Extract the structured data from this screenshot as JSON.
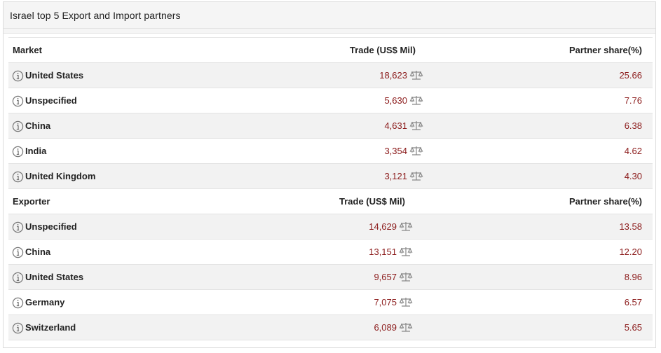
{
  "panel": {
    "title": "Israel top 5 Export and Import partners"
  },
  "sections": [
    {
      "headers": {
        "name": "Market",
        "trade": "Trade (US$ Mil)",
        "share": "Partner share(%)"
      },
      "rows": [
        {
          "name": "United States",
          "trade": "18,623",
          "share": "25.66"
        },
        {
          "name": "Unspecified",
          "trade": "5,630",
          "share": "7.76"
        },
        {
          "name": "China",
          "trade": "4,631",
          "share": "6.38"
        },
        {
          "name": "India",
          "trade": "3,354",
          "share": "4.62"
        },
        {
          "name": "United Kingdom",
          "trade": "3,121",
          "share": "4.30"
        }
      ]
    },
    {
      "headers": {
        "name": "Exporter",
        "trade": "Trade (US$ Mil)",
        "share": "Partner share(%)"
      },
      "rows": [
        {
          "name": "Unspecified",
          "trade": "14,629",
          "share": "13.58"
        },
        {
          "name": "China",
          "trade": "13,151",
          "share": "12.20"
        },
        {
          "name": "United States",
          "trade": "9,657",
          "share": "8.96"
        },
        {
          "name": "Germany",
          "trade": "7,075",
          "share": "6.57"
        },
        {
          "name": "Switzerland",
          "trade": "6,089",
          "share": "5.65"
        }
      ]
    }
  ],
  "icons": {
    "info": "info-circle-icon",
    "compare": "balance-scale-icon"
  },
  "colors": {
    "value": "#8b1a1a",
    "alt_row": "#f2f2f2",
    "header_bg": "#f5f5f5"
  }
}
